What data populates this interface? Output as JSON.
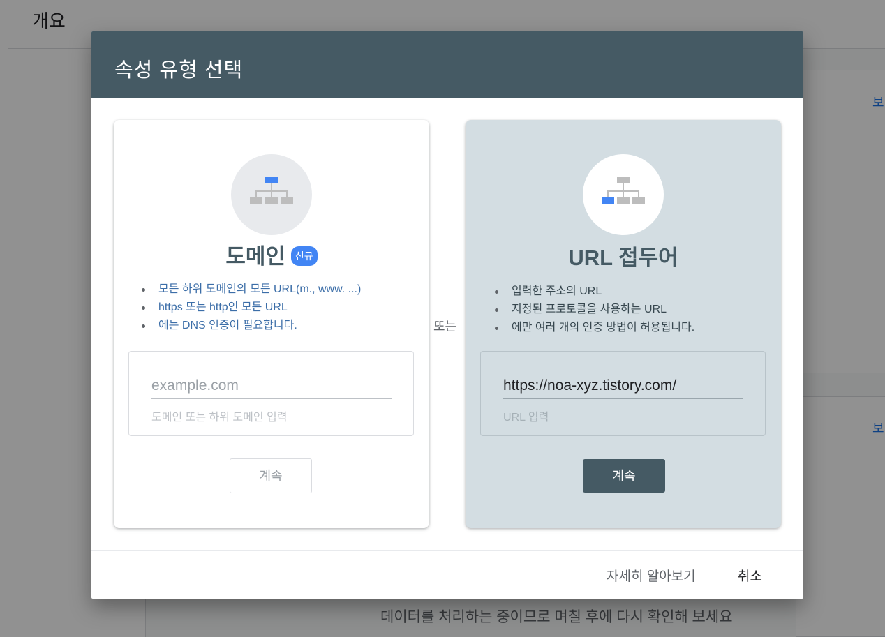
{
  "background": {
    "page_title": "개요",
    "side_link_1": "보",
    "side_link_2": "보",
    "message": "데이터를 처리하는 중이므로 며칠 후에 다시 확인해 보세요"
  },
  "dialog": {
    "title": "속성 유형 선택",
    "or_label": "또는",
    "domain": {
      "title": "도메인",
      "badge": "신규",
      "bullets": [
        "모든 하위 도메인의 모든 URL(m., www. ...)",
        "https 또는 http인 모든 URL",
        "에는 DNS 인증이 필요합니다."
      ],
      "input_value": "",
      "input_placeholder": "example.com",
      "input_hint": "도메인 또는 하위 도메인 입력",
      "continue_label": "계속"
    },
    "url_prefix": {
      "title": "URL 접두어",
      "bullets": [
        "입력한 주소의 URL",
        "지정된 프로토콜을 사용하는 URL",
        "에만 여러 개의 인증 방법이 허용됩니다."
      ],
      "input_value": "https://noa-xyz.tistory.com/",
      "input_placeholder": "",
      "input_hint": "URL 입력",
      "continue_label": "계속"
    },
    "footer": {
      "learn_more": "자세히 알아보기",
      "cancel": "취소"
    }
  },
  "colors": {
    "header": "#455a64",
    "selected_card": "#d3dde2",
    "accent_blue": "#4285f4",
    "node_gray": "#bdbdbd"
  },
  "icons": {
    "domain": "sitemap-top-highlighted-icon",
    "url_prefix": "sitemap-leaf-highlighted-icon"
  }
}
